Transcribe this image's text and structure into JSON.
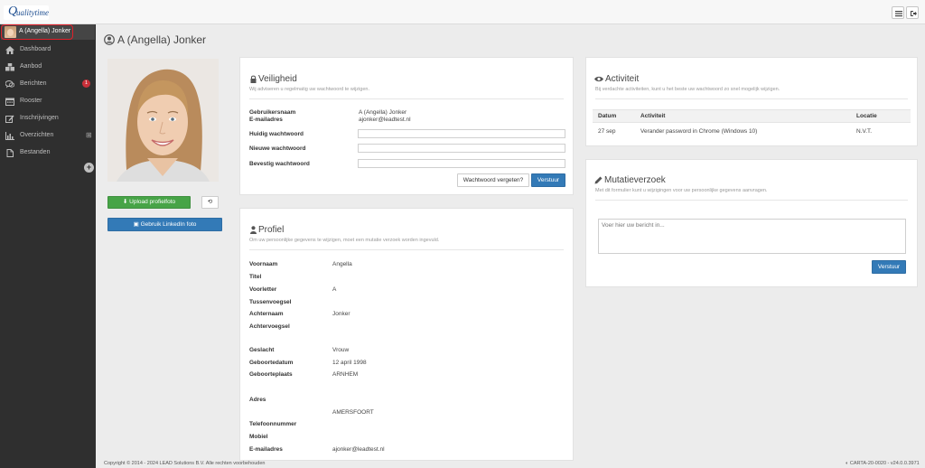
{
  "app": {
    "logo_initial": "Q",
    "logo_text": "ualitytime"
  },
  "sidebar": {
    "user_name": "A (Angella) Jonker",
    "items": [
      {
        "label": "Dashboard"
      },
      {
        "label": "Aanbod"
      },
      {
        "label": "Berichten",
        "badge": "1"
      },
      {
        "label": "Rooster"
      },
      {
        "label": "Inschrijvingen"
      },
      {
        "label": "Overzichten",
        "expand": "⊞"
      },
      {
        "label": "Bestanden"
      }
    ],
    "collapse_icon": "+"
  },
  "header": {
    "title": "A (Angella) Jonker"
  },
  "profile_photo": {
    "upload_label": "Upload profielfoto",
    "linkedin_label": "Gebruik LinkedIn foto"
  },
  "security": {
    "title": "Veiligheid",
    "subtitle": "Wij adviseren u regelmatig uw wachtwoord te wijzigen.",
    "username_label": "Gebruikersnaam",
    "username_value": "A (Angella) Jonker",
    "email_label": "E-mailadres",
    "email_value": "ajonker@leadtest.nl",
    "current_pw_label": "Huidig wachtwoord",
    "new_pw_label": "Nieuwe wachtwoord",
    "confirm_pw_label": "Bevestig wachtwoord",
    "current_pw_value": "",
    "new_pw_value": "",
    "confirm_pw_value": "",
    "forgot_label": "Wachtwoord vergeten?",
    "submit_label": "Verstuur"
  },
  "profile": {
    "title": "Profiel",
    "subtitle": "Om uw persoonlijke gegevens te wijzigen, moet een mutatie verzoek worden ingevuld.",
    "voornaam_label": "Voornaam",
    "voornaam_value": "Angella",
    "titel_label": "Titel",
    "titel_value": "",
    "voorletter_label": "Voorletter",
    "voorletter_value": "A",
    "tussenvoegsel_label": "Tussenvoegsel",
    "tussenvoegsel_value": "",
    "achternaam_label": "Achternaam",
    "achternaam_value": "Jonker",
    "achtervoegsel_label": "Achtervoegsel",
    "achtervoegsel_value": "",
    "geslacht_label": "Geslacht",
    "geslacht_value": "Vrouw",
    "geboortedatum_label": "Geboortedatum",
    "geboortedatum_value": "12 april 1998",
    "geboorteplaats_label": "Geboorteplaats",
    "geboorteplaats_value": "ARNHEM",
    "adres_label": "Adres",
    "adres_value": "",
    "plaats_value": "AMERSFOORT",
    "telefoon_label": "Telefoonnummer",
    "telefoon_value": "",
    "mobiel_label": "Mobiel",
    "mobiel_value": "",
    "email_label": "E-mailadres",
    "email_value": "ajonker@leadtest.nl"
  },
  "activity": {
    "title": "Activiteit",
    "subtitle": "Bij verdachte activiteiten, kunt u het beste uw wachtwoord zo snel mogelijk wijzigen.",
    "columns": {
      "date": "Datum",
      "activity": "Activiteit",
      "location": "Locatie"
    },
    "rows": [
      {
        "date": "27 sep",
        "activity": "Verander password in Chrome (Windows 10)",
        "location": "N.V.T."
      }
    ]
  },
  "mutation": {
    "title": "Mutatieverzoek",
    "subtitle": "Met dit formulier kunt u wijzigingen voor uw persoonlijke gegevens aanvragen.",
    "placeholder": "Voer hier uw bericht in...",
    "submit_label": "Verstuur"
  },
  "footer": {
    "copyright": "Copyright © 2014 - 2024 LEAD Solutions B.V. Alle rechten voorbehouden",
    "version": "CARTA-20-0020 - v24.0.0.3971"
  }
}
